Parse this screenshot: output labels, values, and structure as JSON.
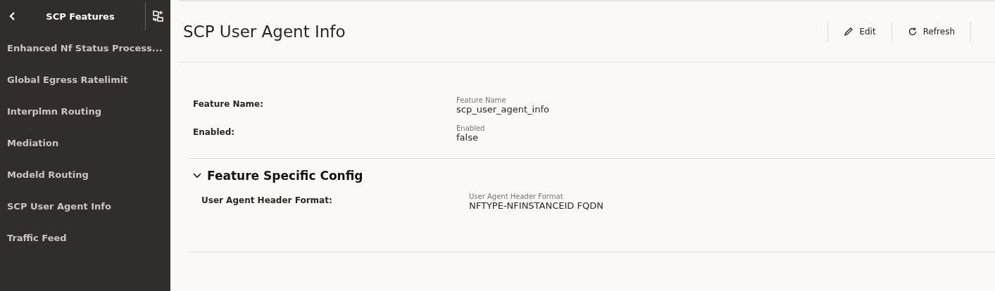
{
  "sidebar": {
    "title": "SCP Features",
    "items": [
      {
        "label": "Enhanced Nf Status Process..."
      },
      {
        "label": "Global Egress Ratelimit"
      },
      {
        "label": "Interplmn Routing"
      },
      {
        "label": "Mediation"
      },
      {
        "label": "Modeld Routing"
      },
      {
        "label": "SCP User Agent Info"
      },
      {
        "label": "Traffic Feed"
      }
    ]
  },
  "page": {
    "title": "SCP User Agent Info",
    "actions": [
      {
        "kind": "edit",
        "label": "Edit"
      },
      {
        "kind": "refresh",
        "label": "Refresh"
      }
    ]
  },
  "fields": [
    {
      "label": "Feature Name:",
      "caption": "Feature Name",
      "value": "scp_user_agent_info"
    },
    {
      "label": "Enabled:",
      "caption": "Enabled",
      "value": "false"
    }
  ],
  "section": {
    "title": "Feature Specific Config",
    "expanded": true,
    "fields": [
      {
        "label": "User Agent Header Format:",
        "caption": "User Agent Header Format",
        "value": "NFTYPE-NFINSTANCEID FQDN"
      }
    ]
  }
}
